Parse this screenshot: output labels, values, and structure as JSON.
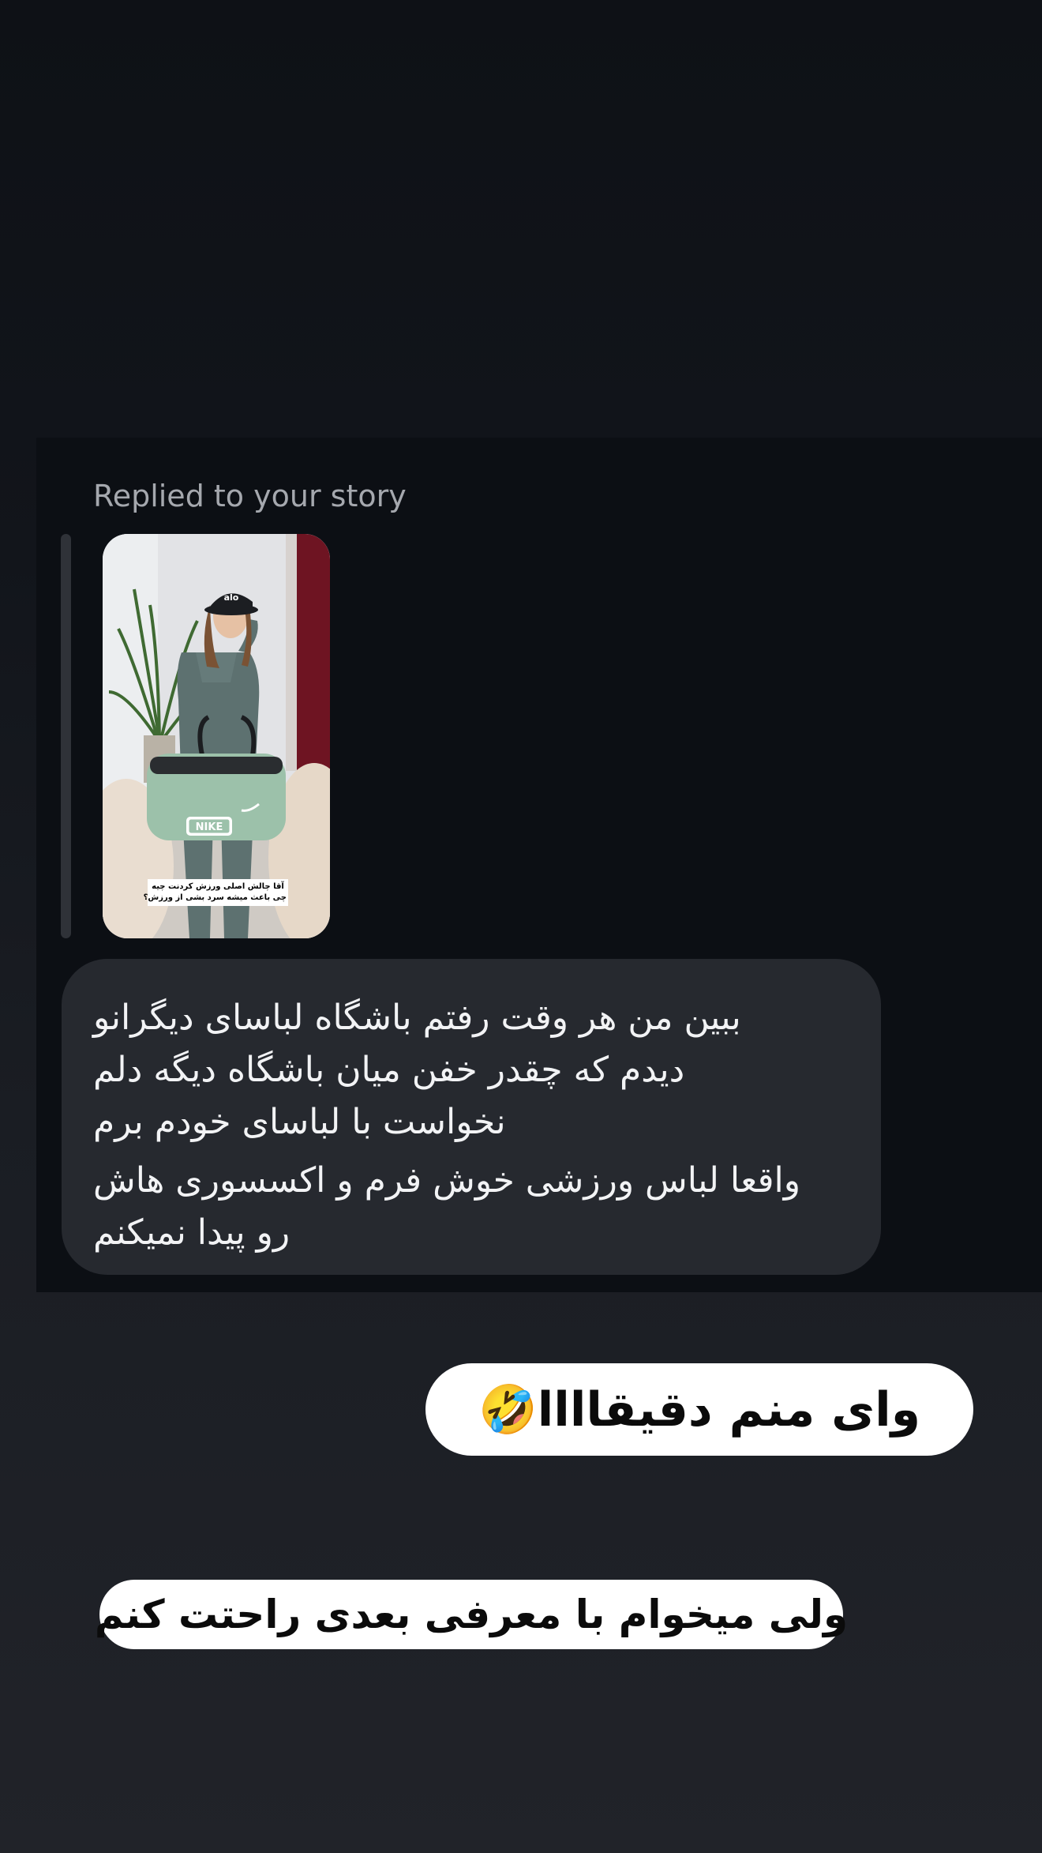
{
  "story_reply": {
    "label": "Replied to your story",
    "story": {
      "caption_line1": "آقا چالش اصلی ورزش کردنت چیه",
      "caption_line2": "چی باعث میشه سرد بشی از ورزش؟",
      "bag_logo": "NIKE",
      "cap_logo": "alo"
    }
  },
  "message": {
    "lines": [
      "ببین من هر وقت رفتم باشگاه لباسای دیگرانو",
      "دیدم که چقدر خفن میان باشگاه دیگه دلم",
      "نخواست با لباسای خودم برم",
      "واقعا لباس ورزشی خوش فرم و اکسسوری هاش",
      "رو پیدا نمیکنم"
    ]
  },
  "stickers": {
    "first": "وای منم دقیقاااا🤣",
    "second": "ولی میخوام با معرفی بعدی راحتت کنم"
  },
  "colors": {
    "bubble": "#26292f",
    "panel": "#0c0f14",
    "sticker_bg": "#ffffff"
  }
}
